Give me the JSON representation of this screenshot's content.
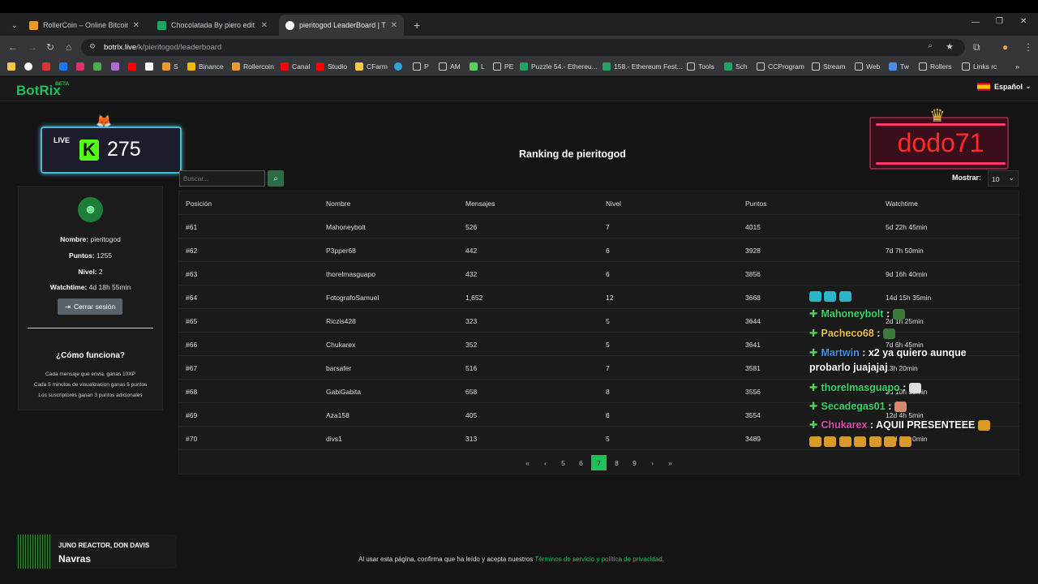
{
  "browser": {
    "tabs": [
      {
        "title": "RollerCoin – Online Bitcoin Mi...",
        "active": false
      },
      {
        "title": "Chocolatada By piero edit ronn...",
        "active": false
      },
      {
        "title": "pieritogod LeaderBoard | The b...",
        "active": true
      }
    ],
    "new_tab": "+",
    "url_host": "botrix.live",
    "url_path": "/k/pieritogod/leaderboard",
    "bookmarks": [
      "S",
      "Binance",
      "Rollercoin",
      "Canal",
      "Studio",
      "CFarm",
      "P",
      "AM",
      "L",
      "PE",
      "Puzzle 54.- Ethereu...",
      "158.- Ethereum Fest...",
      "Tools",
      "Sch",
      "CCProgram",
      "Stream",
      "Web",
      "Tw",
      "Rollers",
      "Links rc"
    ]
  },
  "site": {
    "logo": "BotRix",
    "beta": "BETA",
    "language": "Español"
  },
  "live_widget": {
    "label": "LIVE",
    "k": "K",
    "count": "275"
  },
  "profile": {
    "name_label": "Nombre:",
    "name": "pieritogod",
    "points_label": "Puntos:",
    "points": "1255",
    "level_label": "Nivel:",
    "level": "2",
    "watch_label": "Watchtime:",
    "watch": "4d 18h 55min",
    "logout": "Cerrar sesión",
    "how_title": "¿Cómo funciona?",
    "how_lines": [
      "Cada mensaje que envia, ganas 10XP",
      "Cada 5 minutos de visualizacion ganas 5 puntos",
      "Los suscriptores ganan 3 puntos adicionales"
    ]
  },
  "ranking": {
    "title": "Ranking de pieritogod",
    "search_placeholder": "Buscar...",
    "show_label": "Mostrar:",
    "show_value": "10",
    "headers": [
      "Posición",
      "Nombre",
      "Mensajes",
      "Nivel",
      "Puntos",
      "Watchtime"
    ],
    "rows": [
      [
        "#61",
        "Mahoneybolt",
        "526",
        "7",
        "4015",
        "5d 22h 45min"
      ],
      [
        "#62",
        "P3pper68",
        "442",
        "6",
        "3928",
        "7d 7h 50min"
      ],
      [
        "#63",
        "thorelmasguapo",
        "432",
        "6",
        "3856",
        "9d 16h 40min"
      ],
      [
        "#64",
        "FotografoSamuel",
        "1,652",
        "12",
        "3668",
        "14d 15h 35min"
      ],
      [
        "#65",
        "Riczis428",
        "323",
        "5",
        "3644",
        "2d 1h 25min"
      ],
      [
        "#66",
        "Chukarex",
        "352",
        "5",
        "3641",
        "7d 6h 45min"
      ],
      [
        "#67",
        "barsafer",
        "516",
        "7",
        "3581",
        "13h 20min"
      ],
      [
        "#68",
        "GabiGabita",
        "658",
        "8",
        "3556",
        "2d 10h 30min"
      ],
      [
        "#69",
        "Aza158",
        "405",
        "6",
        "3554",
        "12d 4h 5min"
      ],
      [
        "#70",
        "divs1",
        "313",
        "5",
        "3489",
        "10d 13h 0min"
      ]
    ],
    "pages": [
      "5",
      "6",
      "7",
      "8",
      "9"
    ],
    "active_page": "7",
    "first": "«",
    "prev": "‹",
    "next": "›",
    "last": "»"
  },
  "overlay": {
    "dodo": "dodo71",
    "chat": [
      {
        "user": "Mahoneybolt",
        "color": "#3dd56d",
        "msg": ":"
      },
      {
        "user": "Pacheco68",
        "color": "#e8c547",
        "msg": ":"
      },
      {
        "user": "Martwin",
        "color": "#4a90e2",
        "msg": ": x2 ya quiero aunque"
      },
      {
        "user": "",
        "color": "#fff",
        "msg": "probarlo juajajaj"
      },
      {
        "user": "thorelmasguapo",
        "color": "#3dd56d",
        "msg": ":"
      },
      {
        "user": "Secadegas01",
        "color": "#3dd56d",
        "msg": ":"
      },
      {
        "user": "Chukarex",
        "color": "#e04fb3",
        "msg": ": AQUII PRESENTEEE"
      }
    ],
    "music_artist": "JUNO REACTOR, DON DAVIS",
    "music_song": "Navras"
  },
  "footer": {
    "text": "Al usar esta página, confirma que ha leído y acepta nuestros ",
    "link": "Términos de servicio y política de privacidad",
    "end": "."
  }
}
